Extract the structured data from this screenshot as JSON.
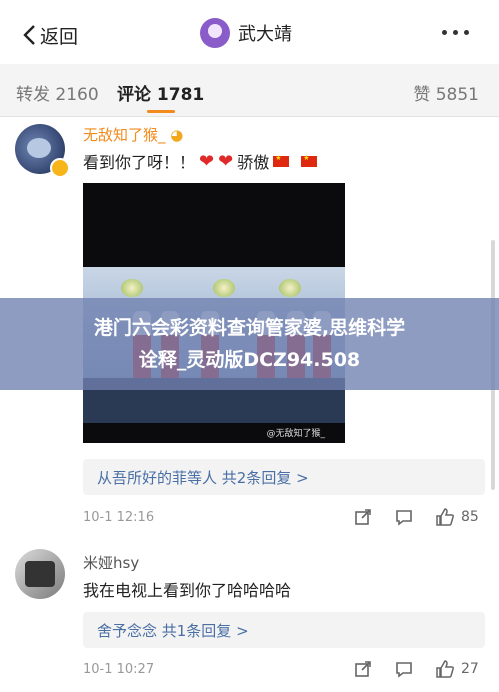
{
  "nav": {
    "back_label": "返回",
    "username": "武大靖"
  },
  "tabs": {
    "repost": "转发 2160",
    "comments": "评论 1781",
    "likes": "赞 5851"
  },
  "comments": [
    {
      "username": "无敌知了猴_",
      "text": "看到你了呀！！",
      "suffix_text": "骄傲",
      "image_watermark": "@无敌知了猴_",
      "replies_label": "从吾所好的菲等人  共2条回复 >",
      "time": "10-1 12:16",
      "likes": "85"
    },
    {
      "username": "米娅hsy",
      "text": "我在电视上看到你了哈哈哈哈",
      "replies_label": "舍予念念  共1条回复 >",
      "time": "10-1 10:27",
      "likes": "27"
    }
  ],
  "banner": {
    "line1": "港门六会彩资料查询管家婆,思维科学",
    "line2": "诠释_灵动版DCZ94.508"
  },
  "colors": {
    "accent": "#f28a1c",
    "link": "#4a6fa5",
    "banner": "#7080b0"
  }
}
